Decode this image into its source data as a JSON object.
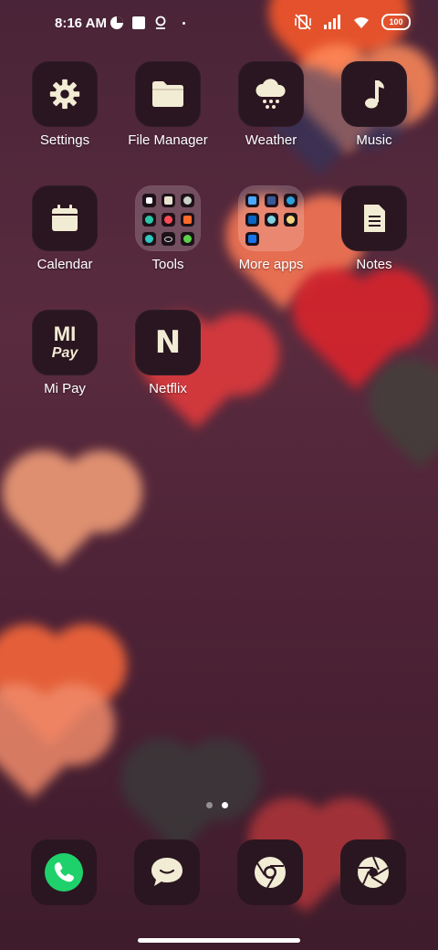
{
  "status": {
    "time": "8:16 AM",
    "battery": "100"
  },
  "apps": [
    {
      "label": "Settings",
      "icon": "gear-icon"
    },
    {
      "label": "File Manager",
      "icon": "folder-icon"
    },
    {
      "label": "Weather",
      "icon": "cloud-snow-icon"
    },
    {
      "label": "Music",
      "icon": "music-note-icon"
    },
    {
      "label": "Calendar",
      "icon": "calendar-icon"
    },
    {
      "label": "Tools",
      "icon": "folder-grid-icon"
    },
    {
      "label": "More apps",
      "icon": "folder-grid-icon"
    },
    {
      "label": "Notes",
      "icon": "document-icon"
    },
    {
      "label": "Mi Pay",
      "icon": "mi-pay-logo-icon",
      "logo_text": {
        "top": "MI",
        "bottom": "Pay"
      }
    },
    {
      "label": "Netflix",
      "icon": "netflix-logo-icon",
      "logo_text": "N"
    }
  ],
  "pager": {
    "count": 2,
    "active": 1
  },
  "dock": [
    {
      "name": "phone",
      "icon": "phone-icon"
    },
    {
      "name": "messages",
      "icon": "chat-bubble-icon"
    },
    {
      "name": "browser",
      "icon": "chrome-icon"
    },
    {
      "name": "camera",
      "icon": "camera-aperture-icon"
    }
  ],
  "colors": {
    "accent_phone": "#1fd16a",
    "icon_tint": "#f3ecd5"
  }
}
